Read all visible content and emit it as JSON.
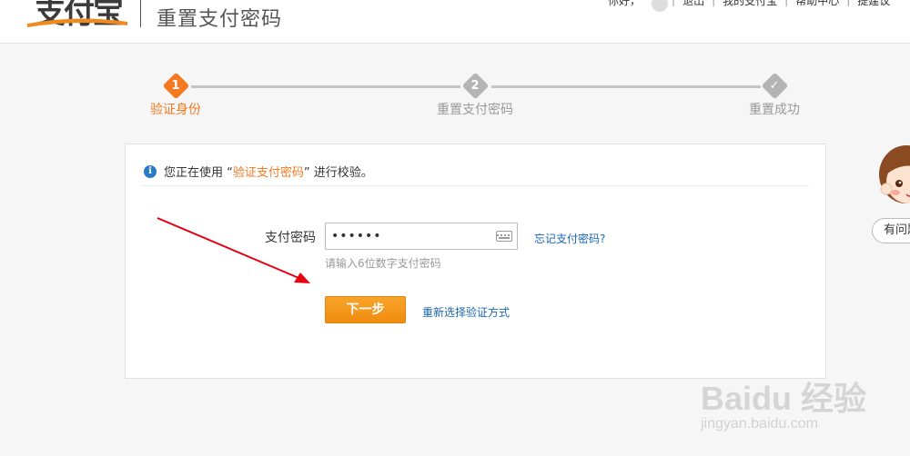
{
  "header": {
    "logo_text": "支付宝",
    "page_title": "重置支付密码",
    "nav": [
      "你好，",
      "退出",
      "我的支付宝",
      "帮助中心",
      "提建议"
    ]
  },
  "steps": [
    {
      "num": "1",
      "label": "验证身份",
      "state": "active"
    },
    {
      "num": "2",
      "label": "重置支付密码",
      "state": "todo"
    },
    {
      "num": "✓",
      "label": "重置成功",
      "state": "todo"
    }
  ],
  "notice": {
    "icon": "info-icon",
    "prefix": "您正在使用 “",
    "highlight": "验证支付密码",
    "suffix": "” 进行校验。"
  },
  "form": {
    "password_label": "支付密码",
    "password_value": "••••••",
    "keyboard_icon": "keyboard-icon",
    "forgot_link": "忘记支付密码?",
    "hint": "请输入6位数字支付密码",
    "next_button": "下一步",
    "reselect_link": "重新选择验证方式"
  },
  "helper": {
    "button_label": "有问题?"
  },
  "watermark": {
    "main": "Baidu 经验",
    "sub": "jingyan.baidu.com"
  },
  "colors": {
    "accent": "#f47920",
    "link": "#1a66b3",
    "button": "#f29b1e",
    "info_icon": "#2a7bc6",
    "annotation_arrow": "#e60012"
  }
}
